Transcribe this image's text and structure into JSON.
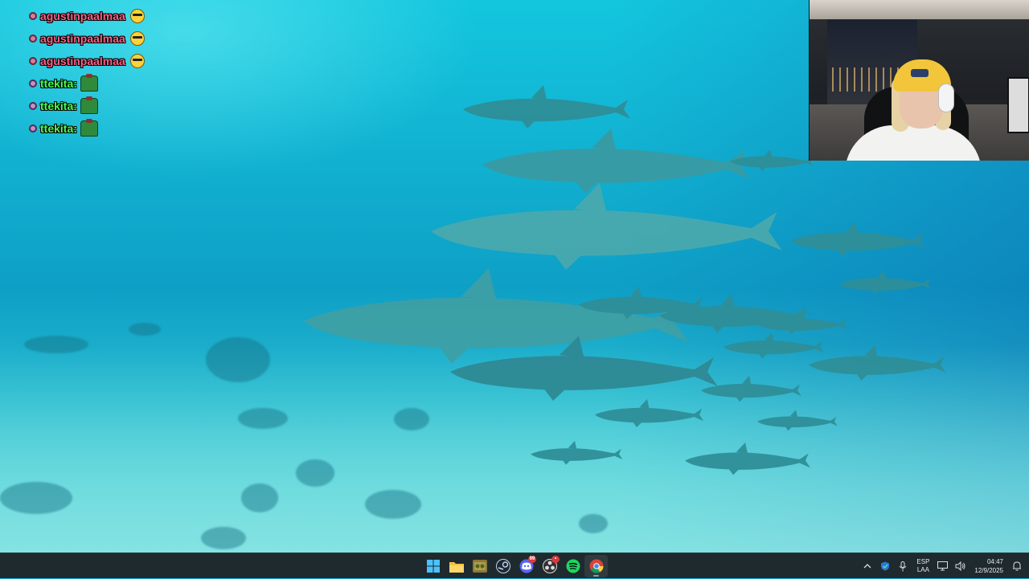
{
  "chat": {
    "messages": [
      {
        "user": "agustinpaalmaa",
        "color": "#ff5f86",
        "emote": "sunglasses-emote"
      },
      {
        "user": "agustinpaalmaa",
        "color": "#ff5f86",
        "emote": "sunglasses-emote"
      },
      {
        "user": "agustinpaalmaa",
        "color": "#ff5f86",
        "emote": "sunglasses-emote"
      },
      {
        "user": "ttekita:",
        "color": "#4cff4c",
        "emote": "green-box-emote"
      },
      {
        "user": "ttekita:",
        "color": "#4cff4c",
        "emote": "green-box-emote"
      },
      {
        "user": "ttekita:",
        "color": "#4cff4c",
        "emote": "green-box-emote"
      }
    ]
  },
  "taskbar": {
    "apps": [
      {
        "name": "start-button",
        "icon": "windows-logo-icon",
        "badge": ""
      },
      {
        "name": "file-explorer",
        "icon": "folder-icon",
        "badge": ""
      },
      {
        "name": "app-game",
        "icon": "game-launcher-icon",
        "badge": ""
      },
      {
        "name": "steam",
        "icon": "steam-icon",
        "badge": ""
      },
      {
        "name": "discord",
        "icon": "discord-icon",
        "badge": "99"
      },
      {
        "name": "obs",
        "icon": "obs-icon",
        "badge": "•"
      },
      {
        "name": "spotify",
        "icon": "spotify-icon",
        "badge": ""
      },
      {
        "name": "chrome",
        "icon": "chrome-icon",
        "badge": ""
      }
    ],
    "tray": {
      "language_line1": "ESP",
      "language_line2": "LAA",
      "time": "04:47",
      "date": "12/9/2025"
    }
  },
  "colors": {
    "taskbar_bg": "#1f2a2f",
    "ocean_top": "#13c6de",
    "ocean_bottom": "#6fd8dc"
  }
}
